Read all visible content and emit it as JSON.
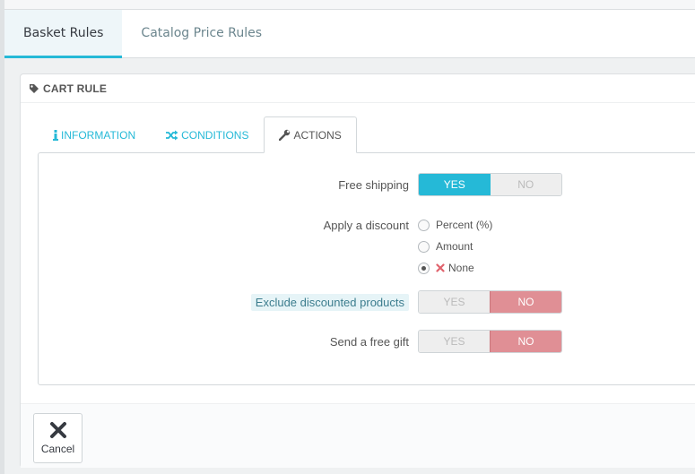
{
  "page_tabs": [
    {
      "label": "Basket Rules",
      "active": true
    },
    {
      "label": "Catalog Price Rules",
      "active": false
    }
  ],
  "panel": {
    "heading": "CART RULE",
    "heading_icon": "tag-icon"
  },
  "sub_tabs": [
    {
      "label": "INFORMATION",
      "icon": "info-icon"
    },
    {
      "label": "CONDITIONS",
      "icon": "shuffle-icon"
    },
    {
      "label": "ACTIONS",
      "icon": "wrench-icon",
      "active": true
    }
  ],
  "form": {
    "free_shipping": {
      "label": "Free shipping",
      "yes": "YES",
      "no": "NO",
      "value": "YES"
    },
    "apply_discount": {
      "label": "Apply a discount",
      "options": [
        "Percent (%)",
        "Amount",
        "None"
      ],
      "selected": "None"
    },
    "exclude_discounted": {
      "label": "Exclude discounted products",
      "yes": "YES",
      "no": "NO",
      "value": "NO"
    },
    "free_gift": {
      "label": "Send a free gift",
      "yes": "YES",
      "no": "NO",
      "value": "NO"
    }
  },
  "footer": {
    "cancel_label": "Cancel"
  },
  "colors": {
    "accent": "#25b9d7",
    "no_active": "#e08f95",
    "none_icon": "#e0636d"
  }
}
